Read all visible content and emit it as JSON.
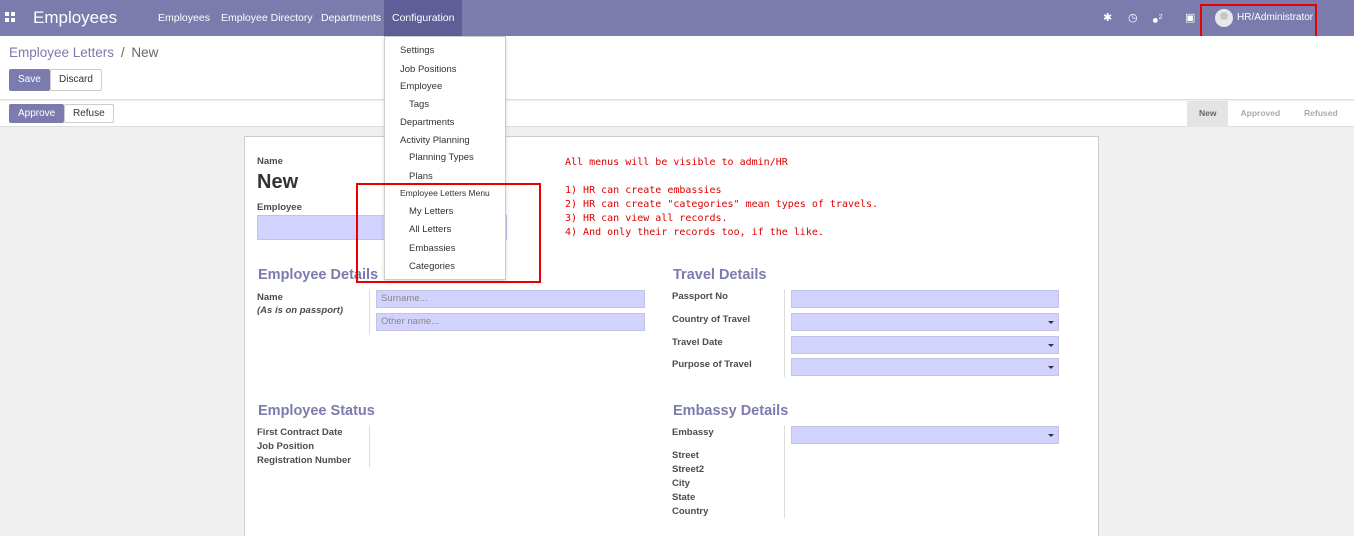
{
  "navbar": {
    "brand": "Employees",
    "menu": [
      "Employees",
      "Employee Directory",
      "Departments",
      "Configuration"
    ],
    "notification_count": "2",
    "user": "HR/Administrator"
  },
  "control": {
    "breadcrumb_parent": "Employee Letters",
    "breadcrumb_sep": "/",
    "breadcrumb_current": "New",
    "save_label": "Save",
    "discard_label": "Discard"
  },
  "statusbar": {
    "approve_label": "Approve",
    "refuse_label": "Refuse",
    "steps": [
      "New",
      "Approved",
      "Refused"
    ]
  },
  "dropdown": {
    "settings": "Settings",
    "job_positions": "Job Positions",
    "employee": "Employee",
    "tags": "Tags",
    "departments": "Departments",
    "activity_planning": "Activity Planning",
    "planning_types": "Planning Types",
    "plans": "Plans",
    "letters_menu": "Employee Letters Menu",
    "my_letters": "My Letters",
    "all_letters": "All Letters",
    "embassies": "Embassies",
    "categories": "Categories"
  },
  "form": {
    "name_label": "Name",
    "record_name": "New",
    "employee_label": "Employee",
    "employee_details_title": "Employee Details",
    "name_field_label": "Name",
    "name_hint": "(As is on passport)",
    "surname_placeholder": "Surname...",
    "other_name_placeholder": "Other name...",
    "travel_details_title": "Travel Details",
    "passport_no": "Passport No",
    "country_of_travel": "Country of Travel",
    "travel_date": "Travel Date",
    "purpose_of_travel": "Purpose of Travel",
    "employee_status_title": "Employee Status",
    "first_contract_date": "First Contract Date",
    "job_position": "Job Position",
    "registration_number": "Registration Number",
    "embassy_details_title": "Embassy Details",
    "embassy": "Embassy",
    "street": "Street",
    "street2": "Street2",
    "city": "City",
    "state": "State",
    "country": "Country"
  },
  "annotation": {
    "line1": "All menus will be visible to admin/HR",
    "line2": "1) HR can create embassies",
    "line3": "2) HR can create \"categories\" mean types of travels.",
    "line4": "3) HR can view all records.",
    "line5": "4) And only their records too, if the like."
  },
  "colors": {
    "brand": "#7c7bad",
    "field_bg": "#d2d2ff",
    "annotation": "#e00000"
  }
}
